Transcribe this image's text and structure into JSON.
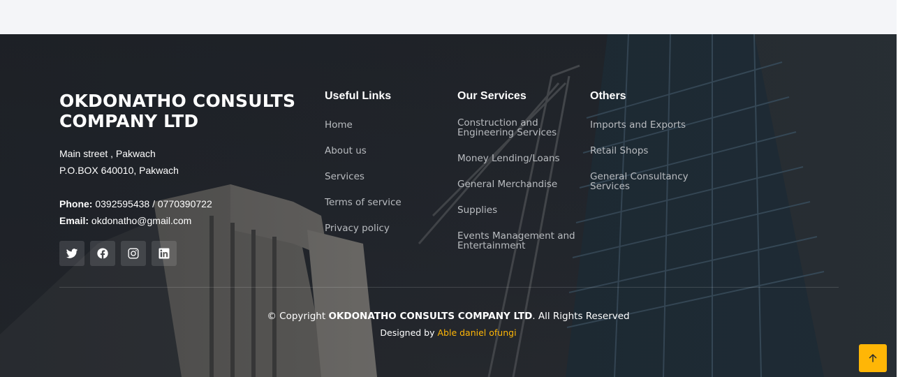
{
  "company": {
    "name": "OKDONATHO CONSULTS COMPANY LTD",
    "address_line1": "Main street , Pakwach",
    "address_line2": "P.O.BOX 640010, Pakwach",
    "phone_label": "Phone:",
    "phone_value": "0392595438 / 0770390722",
    "email_label": "Email:",
    "email_value": "okdonatho@gmail.com"
  },
  "socials": [
    {
      "icon": "twitter-icon"
    },
    {
      "icon": "facebook-icon"
    },
    {
      "icon": "instagram-icon"
    },
    {
      "icon": "linkedin-icon"
    }
  ],
  "useful_links": {
    "title": "Useful Links",
    "items": [
      "Home",
      "About us",
      "Services",
      "Terms of service",
      "Privacy policy"
    ]
  },
  "our_services": {
    "title": "Our Services",
    "items": [
      "Construction and Engineering Services",
      "Money Lending/Loans",
      "General Merchandise",
      "Supplies",
      "Events Management and Entertainment"
    ]
  },
  "others": {
    "title": "Others",
    "items": [
      "Imports and Exports",
      "Retail Shops",
      "General Consultancy Services"
    ]
  },
  "footer": {
    "copyright_prefix": "© Copyright",
    "copyright_company": "OKDONATHO CONSULTS COMPANY LTD",
    "copyright_suffix": ". All Rights Reserved",
    "designed_by_label": "Designed by",
    "designer_name": "Able daniel ofungi"
  },
  "colors": {
    "accent": "#ffb606",
    "footer_bg": "#23272d",
    "link_text": "#b9bcc0"
  },
  "back_to_top_icon": "arrow-up-icon"
}
